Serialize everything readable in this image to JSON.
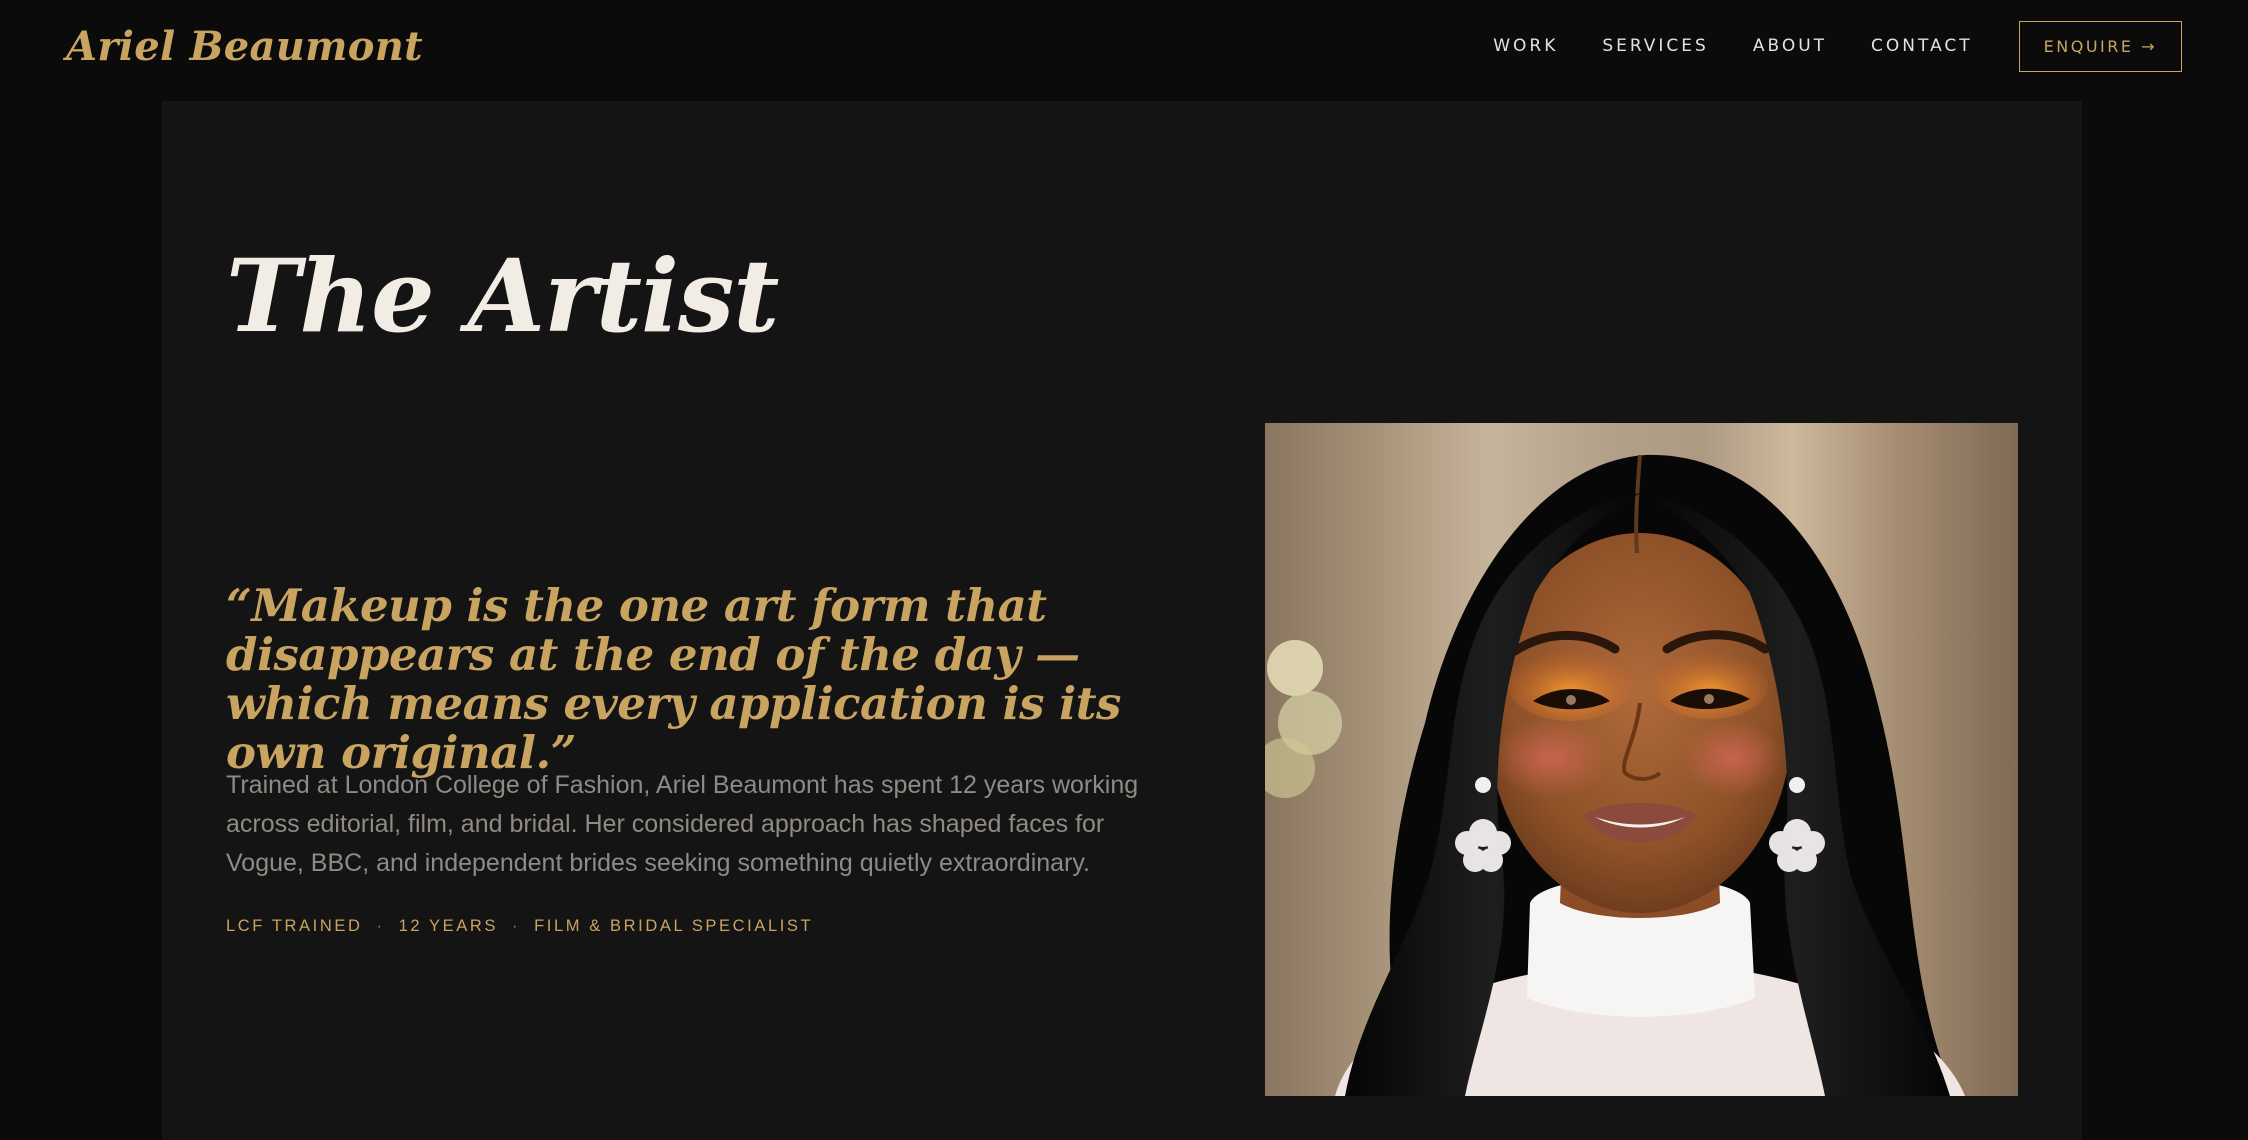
{
  "header": {
    "brand": "Ariel Beaumont",
    "nav": [
      {
        "label": "WORK"
      },
      {
        "label": "SERVICES"
      },
      {
        "label": "ABOUT"
      },
      {
        "label": "CONTACT"
      }
    ],
    "cta_label": "ENQUIRE →"
  },
  "about": {
    "title": "The Artist",
    "quote": "“Makeup is the one art form that disappears at the end of the day — which means every application is its own original.”",
    "bio": "Trained at London College of Fashion, Ariel Beaumont has spent 12 years working across editorial, film, and bridal. Her considered approach has shaped faces for Vogue, BBC, and independent brides seeking something quietly extraordinary.",
    "credentials": [
      "LCF TRAINED",
      "12 YEARS",
      "FILM & BRIDAL SPECIALIST"
    ],
    "separator": "·"
  },
  "colors": {
    "background": "#0b0b0b",
    "panel": "#141414",
    "accent_gold": "#c9a461",
    "heading": "#f1ede5",
    "body_text": "#8f8a84"
  }
}
